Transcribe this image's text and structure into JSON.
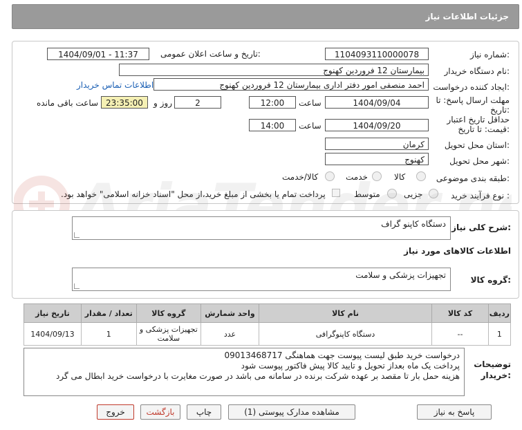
{
  "page_title": "جزئیات اطلاعات نیاز",
  "fields": {
    "need_number_label": "شماره نیاز:",
    "need_number": "1104093110000078",
    "announce_label": "تاریخ و ساعت اعلان عمومی:",
    "announce_value": "1404/09/01 - 11:37",
    "buyer_label": "نام دستگاه خریدار:",
    "buyer_value": "بیمارستان 12 فروردین کهنوج",
    "creator_label": "ایجاد کننده درخواست:",
    "creator_value": "احمد منصفی امور دفتر اداری بیمارستان 12 فروردین کهنوج",
    "contact_link": "اطلاعات تماس خریدار",
    "deadline_label_1": "مهلت ارسال پاسخ: تا",
    "deadline_label_2": "تاریخ:",
    "deadline_date": "1404/09/04",
    "time_label": "ساعت",
    "deadline_time": "12:00",
    "days_value": "2",
    "days_label": "روز و",
    "remaining_time": "23:35:00",
    "remaining_label": "ساعت باقی مانده",
    "validity_label_1": "حداقل تاریخ اعتبار",
    "validity_label_2": "قیمت: تا تاریخ:",
    "validity_date": "1404/09/20",
    "validity_time_label": "ساعت",
    "validity_time": "14:00",
    "province_label": "استان محل تحویل:",
    "province_value": "کرمان",
    "city_label": "شهر محل تحویل:",
    "city_value": "کهنوج",
    "category_label": "طبقه بندی موضوعی:",
    "category_options": [
      "کالا",
      "خدمت",
      "کالا/خدمت"
    ],
    "process_label": "نوع فرآیند خرید :",
    "process_options": [
      "جزیی",
      "متوسط"
    ],
    "payment_note": "پرداخت تمام یا بخشی از مبلغ خرید،از محل \"اسناد خزانه اسلامی\" خواهد بود."
  },
  "summary_label": "شرح کلی نیاز:",
  "summary_value": "دستگاه کاپنو گراف",
  "goods_info_title": "اطلاعات کالاهای مورد نیاز",
  "goods_group_label": "گروه کالا:",
  "goods_group_value": "تجهیزات پزشکی و سلامت",
  "table": {
    "headers": [
      "ردیف",
      "کد کالا",
      "نام کالا",
      "واحد شمارش",
      "گروه کالا",
      "تعداد / مقدار",
      "تاریخ نیاز"
    ],
    "row": {
      "index": "1",
      "code": "--",
      "name": "دستگاه کاپنوگرافی",
      "unit": "عدد",
      "group": "تجهیزات پزشکی و سلامت",
      "qty": "1",
      "date": "1404/09/13"
    }
  },
  "buyer_notes_label_1": "توضیحات",
  "buyer_notes_label_2": "خریدار:",
  "buyer_notes": [
    "درخواست خرید طبق لیست پیوست جهت هماهنگی 09013468717",
    "پرداخت یک  ماه بعداز تحویل و تایید کالا پیش فاکتور پیوست شود",
    "هزینه حمل بار تا مقصد بر عهده شرکت برنده در سامانه می باشد در صورت مغایرت با درخواست خرید ابطال می گرد"
  ],
  "buttons": {
    "reply": "پاسخ به نیاز",
    "attachments": "مشاهده مدارک پیوستی (1)",
    "print": "چاپ",
    "back": "بازگشت",
    "exit": "خروج"
  },
  "colors": {
    "header_bg": "#9a9a9a",
    "remaining_bg": "#f5f0b4",
    "link": "#1a5fb4",
    "exit_border": "#c0392b"
  }
}
